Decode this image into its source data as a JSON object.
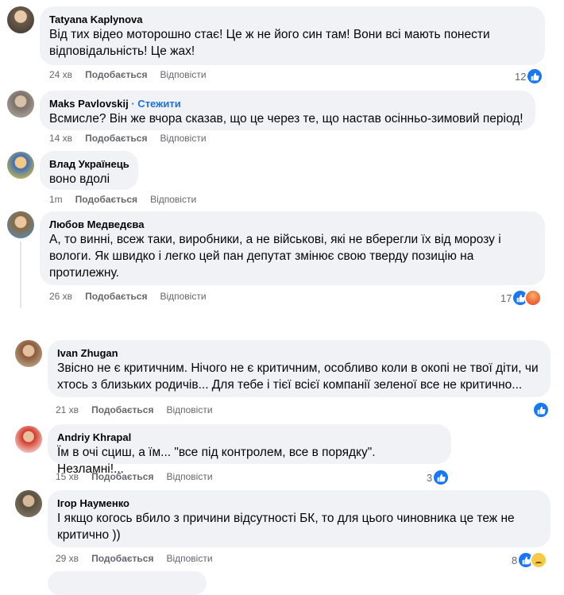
{
  "comments": [
    {
      "author": "Tatyana Kaplynova",
      "follow": "",
      "text": "Від тих відео моторошно стає! Це ж не його син там! Вони всі мають понести відповідальність! Це жах!",
      "time": "24 хв",
      "like": "Подобається",
      "reply": "Відповісти",
      "reactions": "12",
      "reaction_icons": [
        "like-icon"
      ]
    },
    {
      "author": "Maks Pavlovskij",
      "follow": "· Стежити",
      "text": "Всмисле? Він же вчора сказав, що це через те, що настав осінньо-зимовий період!",
      "time": "14 хв",
      "like": "Подобається",
      "reply": "Відповісти",
      "reactions": "",
      "reaction_icons": []
    },
    {
      "author": "Влад Українець",
      "follow": "",
      "text": "воно вдолі",
      "time": "1m",
      "like": "Подобається",
      "reply": "Відповісти",
      "reactions": "",
      "reaction_icons": []
    },
    {
      "author": "Любов Медведєва",
      "follow": "",
      "text": "А, то винні, всеж таки, виробники, а не військові, які не вберегли їх від морозу і вологи. Як швидко і легко цей пан депутат змінює свою тверду позицію на протилежну.",
      "time": "26 хв",
      "like": "Подобається",
      "reply": "Відповісти",
      "reactions": "17",
      "reaction_icons": [
        "like-icon",
        "angry-icon"
      ]
    },
    {
      "author": "Ivan Zhugan",
      "follow": "",
      "text": "Звісно не є критичним. Нічого не є критичним, особливо коли в окопі не твої діти, чи хтось з близьких родичів... Для тебе і тієї всієї компанії зеленої все не критично...",
      "time": "21 хв",
      "like": "Подобається",
      "reply": "Відповісти",
      "reactions": "",
      "reaction_icons": [
        "like-icon"
      ]
    },
    {
      "author": "Andriy Khrapal",
      "follow": "",
      "text": "Їм в очі сциш, а їм... \"все під контролем, все в порядку\". Незламні!...",
      "time": "15 хв",
      "like": "Подобається",
      "reply": "Відповісти",
      "reactions": "3",
      "reaction_icons": [
        "like-icon"
      ]
    },
    {
      "author": "Ігор Науменко",
      "follow": "",
      "text": "І якщо когось вбило з причини відсутності БК, то для цього чиновника це теж не критично ))",
      "time": "29 хв",
      "like": "Подобається",
      "reply": "Відповісти",
      "reactions": "8",
      "reaction_icons": [
        "like-icon",
        "sad-icon"
      ]
    }
  ],
  "colors": {
    "bubble": "#f0f2f5",
    "link": "#216fdb",
    "meta": "#65676b",
    "like": "#1877f2"
  }
}
